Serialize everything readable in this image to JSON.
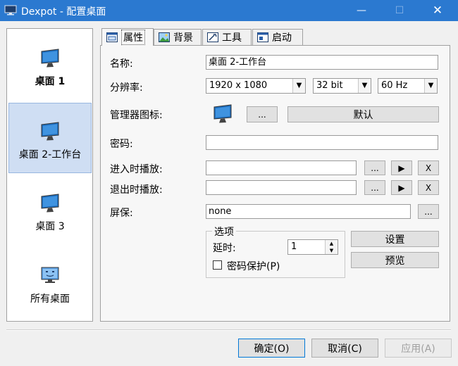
{
  "window": {
    "title": "Dexpot - 配置桌面",
    "minimize_glyph": "—",
    "maximize_glyph": "☐",
    "close_glyph": "✕",
    "app_icon": "monitor-icon"
  },
  "desktops": [
    {
      "label": "桌面 1",
      "bold": true
    },
    {
      "label": "桌面 2-工作台",
      "selected": true
    },
    {
      "label": "桌面 3"
    },
    {
      "label": "所有桌面",
      "icon": "all-desktops-icon"
    }
  ],
  "tabs": [
    {
      "label": "属性",
      "icon": "properties-icon",
      "active": true
    },
    {
      "label": "背景",
      "icon": "background-image-icon"
    },
    {
      "label": "工具",
      "icon": "tools-icon"
    },
    {
      "label": "启动",
      "icon": "startup-icon"
    }
  ],
  "form": {
    "name_label": "名称:",
    "name_value": "桌面 2-工作台",
    "resolution_label": "分辨率:",
    "resolution_value": "1920 x 1080",
    "bitdepth_value": "32 bit",
    "refresh_value": "60 Hz",
    "manager_icon_label": "管理器图标:",
    "browse_label": "...",
    "default_label": "默认",
    "password_label": "密码:",
    "password_value": "",
    "enter_sound_label": "进入时播放:",
    "enter_sound_value": "",
    "exit_sound_label": "退出时播放:",
    "exit_sound_value": "",
    "play_glyph": "▶",
    "clear_label": "X",
    "screensaver_label": "屏保:",
    "screensaver_value": "none",
    "options_title": "选项",
    "delay_label": "延时:",
    "delay_value": "1",
    "password_protect_label": "密码保护(P)",
    "settings_label": "设置",
    "preview_label": "预览"
  },
  "footer": {
    "ok_label": "确定(O)",
    "cancel_label": "取消(C)",
    "apply_label": "应用(A)"
  }
}
